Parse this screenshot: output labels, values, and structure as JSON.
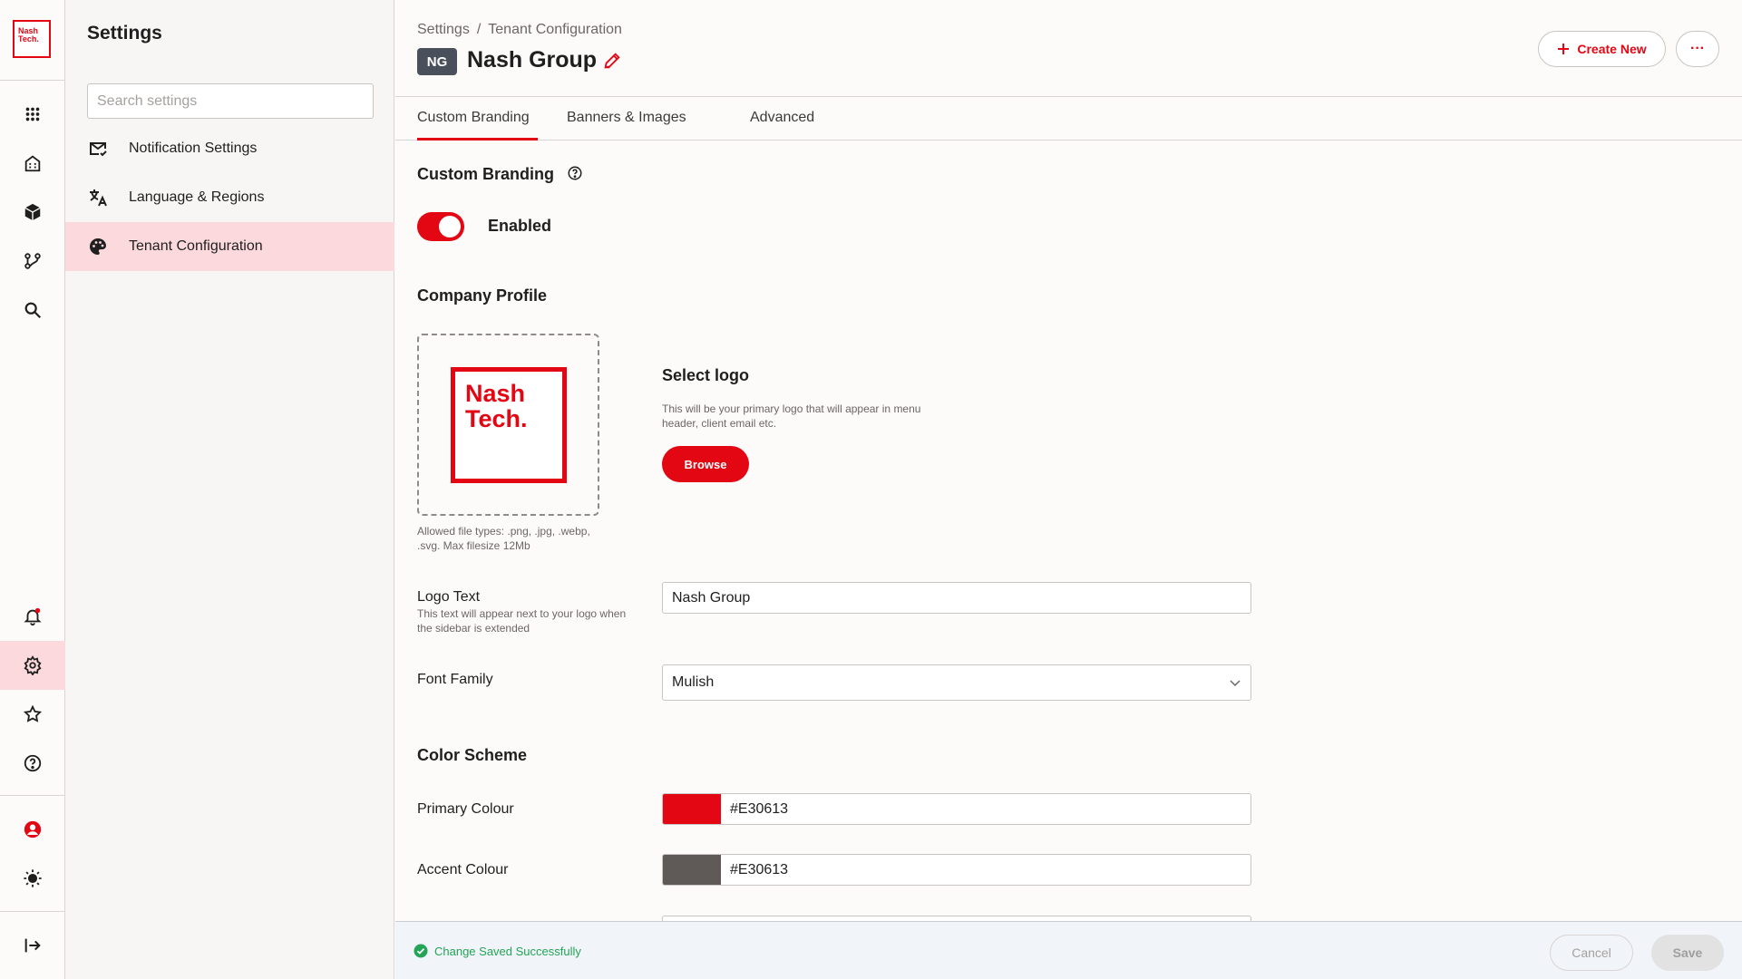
{
  "brand": {
    "logo_line1": "Nash",
    "logo_line2": "Tech.",
    "primary": "#E30613"
  },
  "rail": {
    "top_icons": [
      "grid-icon",
      "building-icon",
      "cube-icon",
      "workflow-icon",
      "search-icon"
    ],
    "bottom_icons": [
      "notification-bell-icon",
      "gear-icon",
      "star-icon",
      "help-circle-icon",
      "user-avatar-icon",
      "sun-icon",
      "expand-sidebar-icon"
    ],
    "active": "gear-icon"
  },
  "settings_panel": {
    "title": "Settings",
    "search_placeholder": "Search settings",
    "items": [
      {
        "label": "Notification Settings",
        "icon": "mail-icon"
      },
      {
        "label": "Language & Regions",
        "icon": "translate-icon"
      },
      {
        "label": "Tenant Configuration",
        "icon": "palette-icon",
        "active": true
      }
    ]
  },
  "header": {
    "breadcrumb": [
      "Settings",
      "Tenant Configuration"
    ],
    "badge": "NG",
    "title": "Nash Group",
    "create_label": "Create New",
    "more_label": "···"
  },
  "tabs": [
    {
      "label": "Custom Branding",
      "active": true
    },
    {
      "label": "Banners & Images"
    },
    {
      "label": "Advanced"
    }
  ],
  "branding": {
    "section_title": "Custom Branding",
    "toggle_label": "Enabled",
    "toggle_on": true
  },
  "company_profile": {
    "title": "Company Profile",
    "allowed_types": "Allowed file types: .png, .jpg, .webp, .svg. Max filesize 12Mb",
    "select_logo_title": "Select logo",
    "select_logo_desc": "This will be your primary logo that will appear in menu header, client email etc.",
    "browse_label": "Browse",
    "logo_text_label": "Logo Text",
    "logo_text_help": "This text will appear next to your logo when the sidebar is extended",
    "logo_text_value": "Nash Group",
    "font_family_label": "Font Family",
    "font_family_value": "Mulish"
  },
  "color_scheme": {
    "title": "Color Scheme",
    "primary_label": "Primary Colour",
    "primary_value": "#E30613",
    "primary_swatch": "#E30613",
    "accent_label": "Accent Colour",
    "accent_value": "#E30613",
    "accent_swatch": "#5F5958"
  },
  "footer": {
    "status": "Change Saved Successfully",
    "cancel_label": "Cancel",
    "save_label": "Save"
  }
}
